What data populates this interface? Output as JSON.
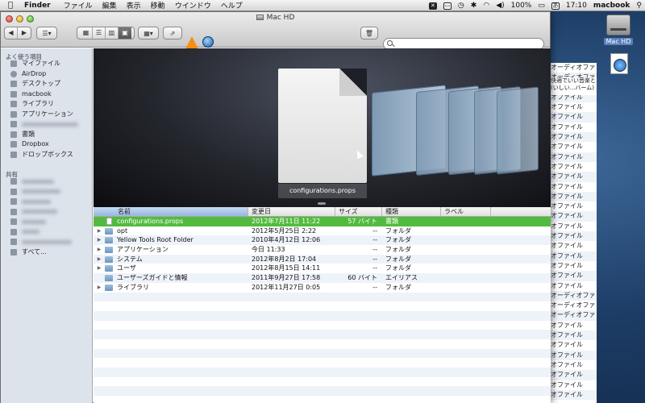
{
  "menubar": {
    "app": "Finder",
    "menus": [
      "ファイル",
      "編集",
      "表示",
      "移動",
      "ウインドウ",
      "ヘルプ"
    ],
    "battery": "100%",
    "time": "17:10",
    "user": "macbook"
  },
  "desktop": {
    "hd_label": "Mac HD",
    "bg_rows": [
      "オーディオファ",
      "オーディオファ",
      "イル",
      "オファイル",
      "オファイル",
      "オファイル",
      "オファイル",
      "オファイル",
      "オファイル",
      "オファイル",
      "オファイル",
      "オファイル",
      "オファイル",
      "オファイル",
      "オファイル",
      "オファイル",
      "オファイル",
      "オファイル",
      "オファイル",
      "オファイル",
      "オファイル",
      "オファイル",
      "オファイル",
      "オーディオファ",
      "オーディオファ",
      "オーディオファ",
      "オファイル",
      "オファイル",
      "オファイル",
      "オファイル",
      "オファイル",
      "オファイル",
      "オファイル",
      "オファイル"
    ],
    "bg_overlay_line1": "快適でいい音楽と",
    "bg_overlay_line2": "(いしい...バーム)"
  },
  "window": {
    "title": "Mac HD",
    "search_placeholder": ""
  },
  "sidebar": {
    "favorites_header": "よく使う項目",
    "favorites": [
      "マイファイル",
      "AirDrop",
      "デスクトップ",
      "macbook",
      "ライブラリ",
      "アプリケーション",
      "",
      "書類",
      "Dropbox",
      "ドロップボックス"
    ],
    "shared_header": "共有",
    "shared_all": "すべて..."
  },
  "coverflow": {
    "selected_label": "configurations.props"
  },
  "list": {
    "columns": {
      "name": "名前",
      "date": "変更日",
      "size": "サイズ",
      "kind": "種類",
      "label": "ラベル"
    },
    "rows": [
      {
        "name": "configurations.props",
        "date": "2012年7月11日 11:22",
        "size": "57 バイト",
        "kind": "書類",
        "selected": true,
        "expandable": false,
        "icon": "document"
      },
      {
        "name": "opt",
        "date": "2012年5月25日 2:22",
        "size": "--",
        "kind": "フォルダ",
        "expandable": true,
        "icon": "folder"
      },
      {
        "name": "Yellow Tools Root Folder",
        "date": "2010年4月12日 12:06",
        "size": "--",
        "kind": "フォルダ",
        "expandable": true,
        "icon": "folder"
      },
      {
        "name": "アプリケーション",
        "date": "今日 11:33",
        "size": "--",
        "kind": "フォルダ",
        "expandable": true,
        "icon": "folder"
      },
      {
        "name": "システム",
        "date": "2012年8月2日 17:04",
        "size": "--",
        "kind": "フォルダ",
        "expandable": true,
        "icon": "folder"
      },
      {
        "name": "ユーザ",
        "date": "2012年8月15日 14:11",
        "size": "--",
        "kind": "フォルダ",
        "expandable": true,
        "icon": "folder"
      },
      {
        "name": "ユーザーズガイドと情報",
        "date": "2011年9月27日 17:58",
        "size": "60 バイト",
        "kind": "エイリアス",
        "expandable": false,
        "icon": "folder"
      },
      {
        "name": "ライブラリ",
        "date": "2012年11月27日 0:05",
        "size": "--",
        "kind": "フォルダ",
        "expandable": true,
        "icon": "folder"
      }
    ]
  }
}
